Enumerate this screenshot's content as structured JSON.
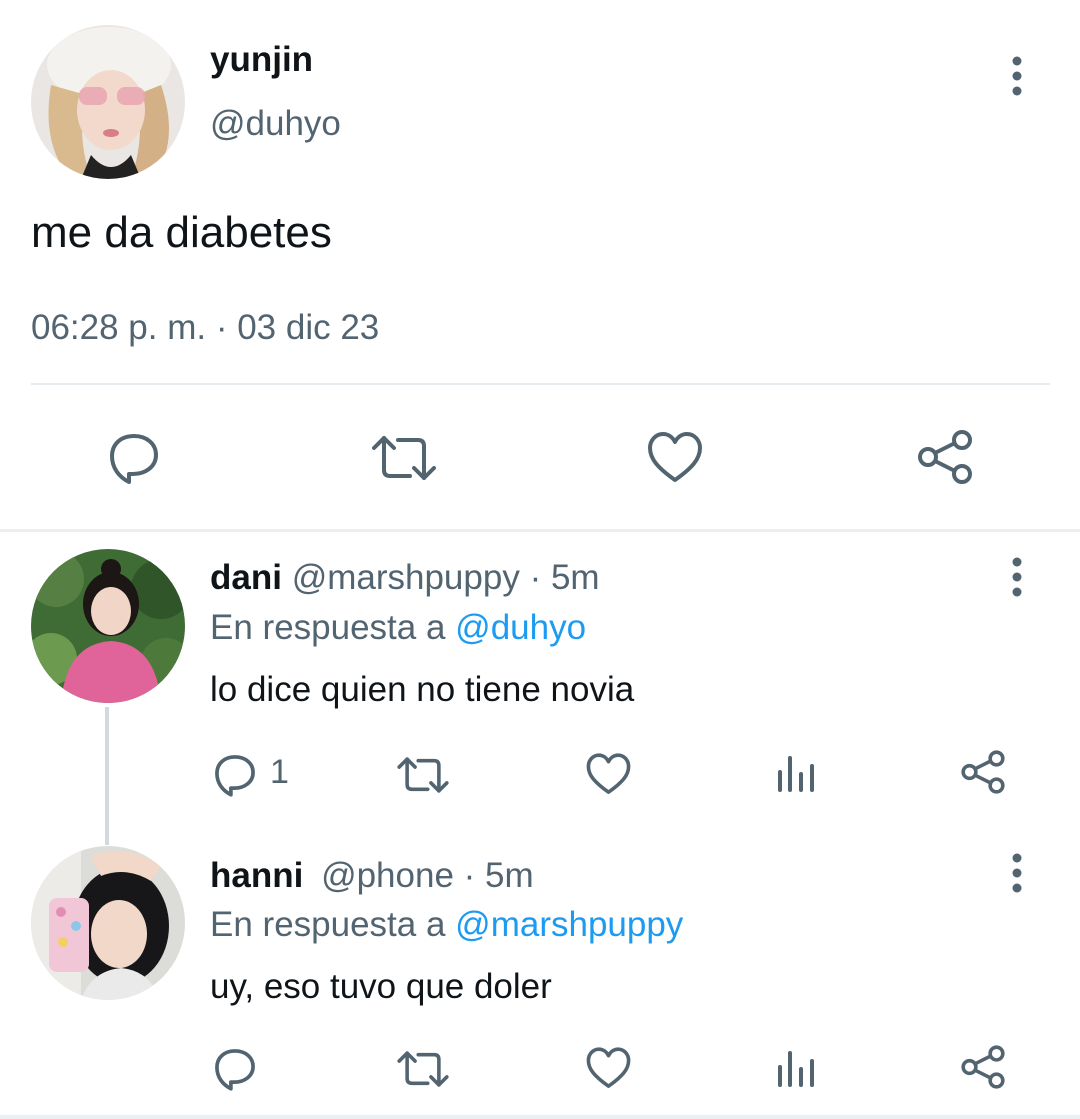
{
  "main_tweet": {
    "name": "yunjin",
    "handle": "@duhyo",
    "text": "me da diabetes",
    "timestamp": "06:28 p. m. · 03 dic 23",
    "more_icon": "more-vertical-icon"
  },
  "replies": [
    {
      "name": "dani",
      "handle": "@marshpuppy",
      "time": "· 5m",
      "reply_prefix": "En respuesta a",
      "reply_to": "@duhyo",
      "text": "lo dice quien no tiene novia",
      "reply_count": "1"
    },
    {
      "name": "hanni",
      "handle": "@phone",
      "time": "· 5m",
      "reply_prefix": "En respuesta a",
      "reply_to": "@marshpuppy",
      "text": "uy, eso tuvo que doler",
      "reply_count": ""
    }
  ],
  "icons": {
    "reply": "comment-icon",
    "retweet": "retweet-icon",
    "like": "heart-icon",
    "views": "views-icon",
    "share": "share-icon"
  },
  "colors": {
    "link": "#1d9bf0",
    "muted": "#536471",
    "icon": "#536471",
    "divider": "#eceff1"
  }
}
